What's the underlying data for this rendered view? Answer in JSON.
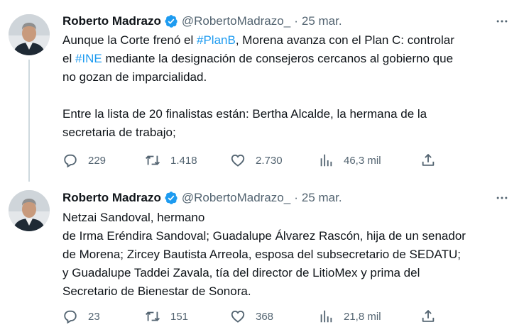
{
  "tweets": [
    {
      "author": {
        "name": "Roberto Madrazo",
        "handle": "@RobertoMadrazo_",
        "separator": "·",
        "date": "25 mar.",
        "avatar": "profile-photo"
      },
      "text": {
        "line1_pre": "Aunque la Corte frenó el ",
        "line1_hashtag": "#PlanB",
        "line1_post": ", Morena avanza con el Plan C: controlar",
        "line2_pre": "el ",
        "line2_hashtag": "#INE",
        "line2_post": " mediante la designación de consejeros cercanos al gobierno que",
        "line3": "no gozan de imparcialidad.",
        "line4": "Entre la lista de 20 finalistas están: Bertha Alcalde, la hermana de la",
        "line5": "secretaria de trabajo;"
      },
      "stats": {
        "replies": "229",
        "retweets": "1.418",
        "likes": "2.730",
        "views": "46,3 mil"
      }
    },
    {
      "author": {
        "name": "Roberto Madrazo",
        "handle": "@RobertoMadrazo_",
        "separator": "·",
        "date": "25 mar.",
        "avatar": "profile-photo"
      },
      "text": {
        "line1": "Netzai Sandoval, hermano",
        "line2": "de Irma Eréndira Sandoval; Guadalupe Álvarez Rascón, hija de un senador",
        "line3": "de Morena; Zircey Bautista Arreola, esposa del subsecretario de SEDATU;",
        "line4": "y Guadalupe Taddei Zavala, tía del director de LitioMex y prima del",
        "line5": "Secretario de Bienestar de Sonora."
      },
      "stats": {
        "replies": "23",
        "retweets": "151",
        "likes": "368",
        "views": "21,8 mil"
      }
    }
  ],
  "icons": {
    "verified": "verified-badge-icon",
    "more": "more-icon",
    "reply": "reply-icon",
    "retweet": "retweet-icon",
    "like": "like-icon",
    "views": "views-icon",
    "share": "share-icon"
  },
  "colors": {
    "text": "#0f1419",
    "secondary": "#536471",
    "accent": "#1d9bf0",
    "thread_line": "#cfd9de"
  }
}
